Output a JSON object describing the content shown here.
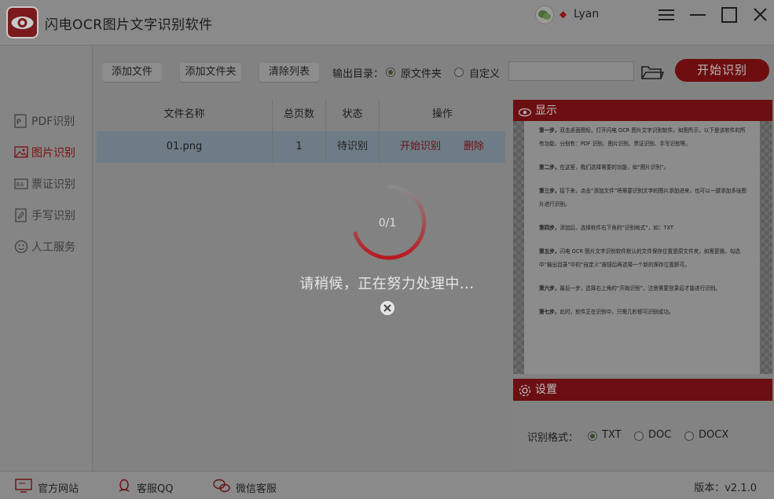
{
  "app": {
    "title": "闪电OCR图片文字识别软件",
    "username": "Lyan"
  },
  "sidebar": {
    "items": [
      {
        "label": "PDF识别",
        "icon": "pdf-icon"
      },
      {
        "label": "图片识别",
        "icon": "image-icon"
      },
      {
        "label": "票证识别",
        "icon": "ticket-icon"
      },
      {
        "label": "手写识别",
        "icon": "handwriting-icon"
      },
      {
        "label": "人工服务",
        "icon": "smile-icon"
      }
    ],
    "active": "图片识别"
  },
  "toolbar": {
    "add_file": "添加文件",
    "add_folder": "添加文件夹",
    "clear_list": "清除列表",
    "output_label": "输出目录：",
    "option_source": "原文件夹",
    "option_custom": "自定义",
    "path_value": "",
    "start": "开始识别"
  },
  "table": {
    "headers": [
      "文件名称",
      "总页数",
      "状态",
      "操作"
    ],
    "rows": [
      {
        "name": "01.png",
        "pages": "1",
        "status": "待识别",
        "action_start": "开始识别",
        "action_delete": "删除"
      }
    ]
  },
  "progress": {
    "text": "0/1",
    "message": "请稍候，正在努力处理中...",
    "fraction": 0.0
  },
  "display_panel": {
    "title": "显示",
    "paragraphs": [
      {
        "step": "第一步，",
        "text": "双击桌面图标，打开闪电 OCR 图片文字识别软件。如图所示，以下是该软件的所有功能，分别有：PDF 识别、图片识别、票证识别、手写识别等。"
      },
      {
        "step": "第二步，",
        "text": "在这里，我们选择需要的功能，如“图片识别”。"
      },
      {
        "step": "第三步，",
        "text": "接下来，点击“添加文件”将需要识别文字的图片添加进来，也可以一键添加多张图片进行识别。"
      },
      {
        "step": "第四步，",
        "text": "添加后，选择软件右下角的“识别格式”，如：TXT"
      },
      {
        "step": "第五步，",
        "text": "闪电 OCR 图片文字识别软件默认的文件保存位置是原文件夹，如需更换，勾选中“输出目录”中的“自定义”按钮后再选择一个新的保存位置即可。"
      },
      {
        "step": "第六步，",
        "text": "最后一步，选择右上角的“开始识别”，注意需要登录后才能进行识别。"
      },
      {
        "step": "第七步，",
        "text": "此时，软件正在识别中，只需几秒即可识别成功。"
      }
    ]
  },
  "settings_panel": {
    "title": "设置",
    "format_label": "识别格式：",
    "formats": [
      "TXT",
      "DOC",
      "DOCX"
    ],
    "selected": "TXT"
  },
  "footer": {
    "website": "官方网站",
    "qq": "客服QQ",
    "wechat": "微信客服",
    "version": "版本：v2.1.0"
  },
  "colors": {
    "brand": "#6b0f12",
    "overlay_text": "#e6e6e6",
    "spinner": "#b81a1f"
  }
}
